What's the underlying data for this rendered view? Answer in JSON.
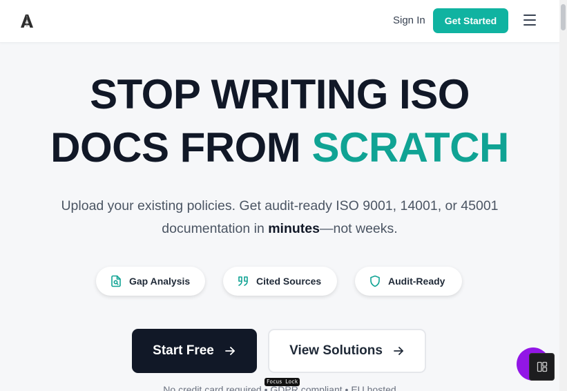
{
  "header": {
    "signin_label": "Sign In",
    "get_started_label": "Get Started",
    "logo_icon": "a-logo-icon",
    "menu_icon": "hamburger-menu-icon"
  },
  "hero": {
    "headline_line1": "STOP WRITING ISO",
    "headline_line2_dark": "DOCS FROM ",
    "headline_line2_accent": "SCRATCH",
    "subtitle_part1": "Upload your existing policies. Get audit-ready ISO 9001, 14001, or 45001 documentation in ",
    "subtitle_bold": "minutes",
    "subtitle_part2": "—not weeks."
  },
  "features": [
    {
      "label": "Gap Analysis",
      "icon": "document-search-icon"
    },
    {
      "label": "Cited Sources",
      "icon": "quote-icon"
    },
    {
      "label": "Audit-Ready",
      "icon": "shield-icon"
    }
  ],
  "cta": {
    "primary_label": "Start Free",
    "secondary_label": "View Solutions"
  },
  "footnote": "No credit card required • GDPR compliant • EU hosted",
  "overlay": {
    "focus_lock_label": "Focus Lock"
  },
  "colors": {
    "accent": "#10b3a1",
    "accent_text": "#10a394",
    "dark": "#111827",
    "chat_bubble": "#9216e6"
  }
}
